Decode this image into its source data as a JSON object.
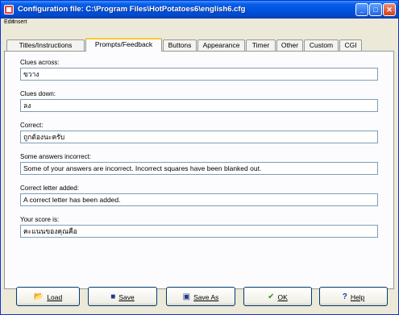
{
  "window": {
    "title": "Configuration file: C:\\Program Files\\HotPotatoes6\\english6.cfg"
  },
  "titlebar_buttons": {
    "minimize": "_",
    "maximize": "□",
    "close": "✕"
  },
  "menu": {
    "items": [
      "Edit",
      "Insert"
    ]
  },
  "tabs": [
    {
      "label": "Titles/Instructions",
      "active": false
    },
    {
      "label": "Prompts/Feedback",
      "active": true
    },
    {
      "label": "Buttons",
      "active": false
    },
    {
      "label": "Appearance",
      "active": false
    },
    {
      "label": "Timer",
      "active": false
    },
    {
      "label": "Other",
      "active": false
    },
    {
      "label": "Custom",
      "active": false
    },
    {
      "label": "CGI",
      "active": false
    }
  ],
  "fields": [
    {
      "label": "Clues across:",
      "value": "ขวาง"
    },
    {
      "label": "Clues down:",
      "value": "ลง"
    },
    {
      "label": "Correct:",
      "value": "ถูกต้องนะครับ"
    },
    {
      "label": "Some answers incorrect:",
      "value": "Some of your answers are incorrect. Incorrect squares have been blanked out."
    },
    {
      "label": "Correct letter added:",
      "value": "A correct letter has been added."
    },
    {
      "label": "Your score is:",
      "value": "คะแนนของคุณคือ"
    }
  ],
  "buttons": {
    "load": {
      "label": "Load",
      "icon": "folder-open-icon"
    },
    "save": {
      "label": "Save",
      "icon": "floppy-disk-icon"
    },
    "save_as": {
      "label": "Save As",
      "icon": "floppy-disk-save-as-icon"
    },
    "ok": {
      "label": "OK",
      "icon": "checkmark-icon"
    },
    "help": {
      "label": "Help",
      "icon": "question-mark-icon"
    }
  }
}
